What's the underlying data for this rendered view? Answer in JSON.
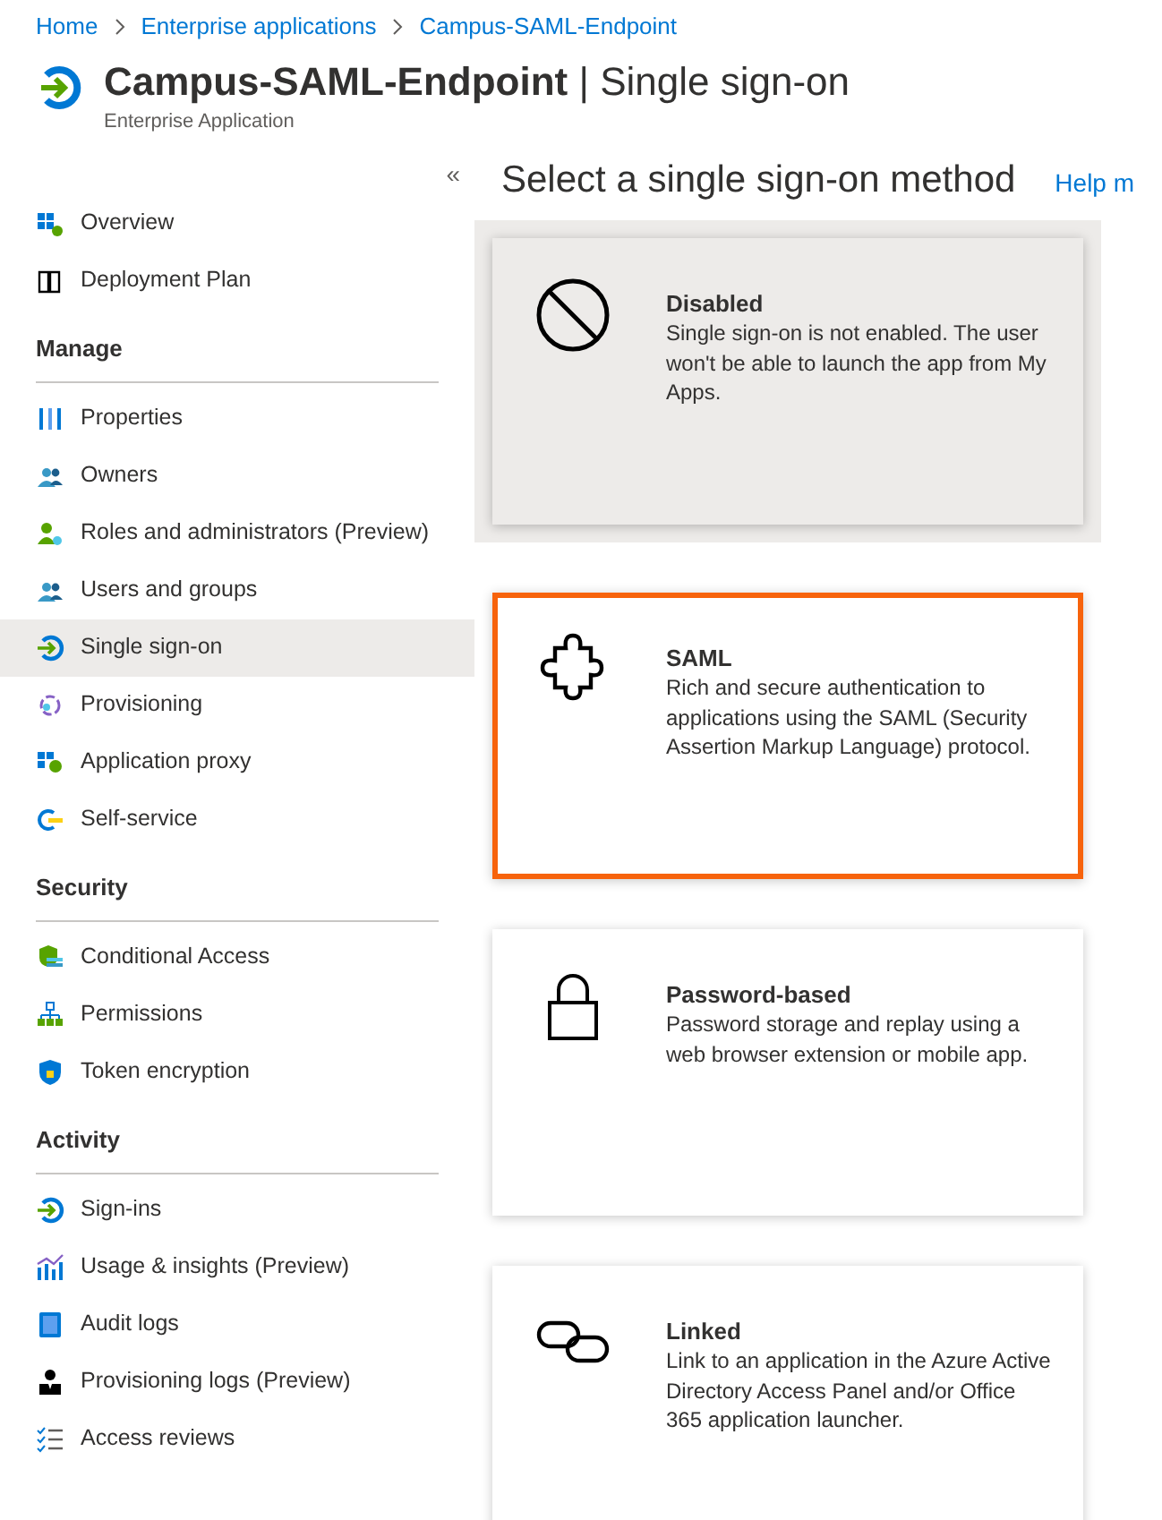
{
  "breadcrumb": [
    "Home",
    "Enterprise applications",
    "Campus-SAML-Endpoint"
  ],
  "header": {
    "app_name": "Campus-SAML-Endpoint",
    "separator": "|",
    "page": "Single sign-on",
    "subtitle": "Enterprise Application"
  },
  "sidebar": {
    "collapse": "«",
    "groups": [
      {
        "items": [
          {
            "label": "Overview",
            "selected": false
          },
          {
            "label": "Deployment Plan",
            "selected": false
          }
        ]
      },
      {
        "title": "Manage",
        "items": [
          {
            "label": "Properties",
            "selected": false
          },
          {
            "label": "Owners",
            "selected": false
          },
          {
            "label": "Roles and administrators (Preview)",
            "selected": false
          },
          {
            "label": "Users and groups",
            "selected": false
          },
          {
            "label": "Single sign-on",
            "selected": true
          },
          {
            "label": "Provisioning",
            "selected": false
          },
          {
            "label": "Application proxy",
            "selected": false
          },
          {
            "label": "Self-service",
            "selected": false
          }
        ]
      },
      {
        "title": "Security",
        "items": [
          {
            "label": "Conditional Access",
            "selected": false
          },
          {
            "label": "Permissions",
            "selected": false
          },
          {
            "label": "Token encryption",
            "selected": false
          }
        ]
      },
      {
        "title": "Activity",
        "items": [
          {
            "label": "Sign-ins",
            "selected": false
          },
          {
            "label": "Usage & insights (Preview)",
            "selected": false
          },
          {
            "label": "Audit logs",
            "selected": false
          },
          {
            "label": "Provisioning logs (Preview)",
            "selected": false
          },
          {
            "label": "Access reviews",
            "selected": false
          }
        ]
      }
    ]
  },
  "main": {
    "title": "Select a single sign-on method",
    "help_link": "Help m",
    "methods": [
      {
        "title": "Disabled",
        "description": "Single sign-on is not enabled. The user won't be able to launch the app from My Apps.",
        "selected": true,
        "highlighted": false
      },
      {
        "title": "SAML",
        "description": "Rich and secure authentication to applications using the SAML (Security Assertion Markup Language) protocol.",
        "selected": false,
        "highlighted": true
      },
      {
        "title": "Password-based",
        "description": "Password storage and replay using a web browser extension or mobile app.",
        "selected": false,
        "highlighted": false
      },
      {
        "title": "Linked",
        "description": "Link to an application in the Azure Active Directory Access Panel and/or Office 365 application launcher.",
        "selected": false,
        "highlighted": false
      }
    ]
  }
}
